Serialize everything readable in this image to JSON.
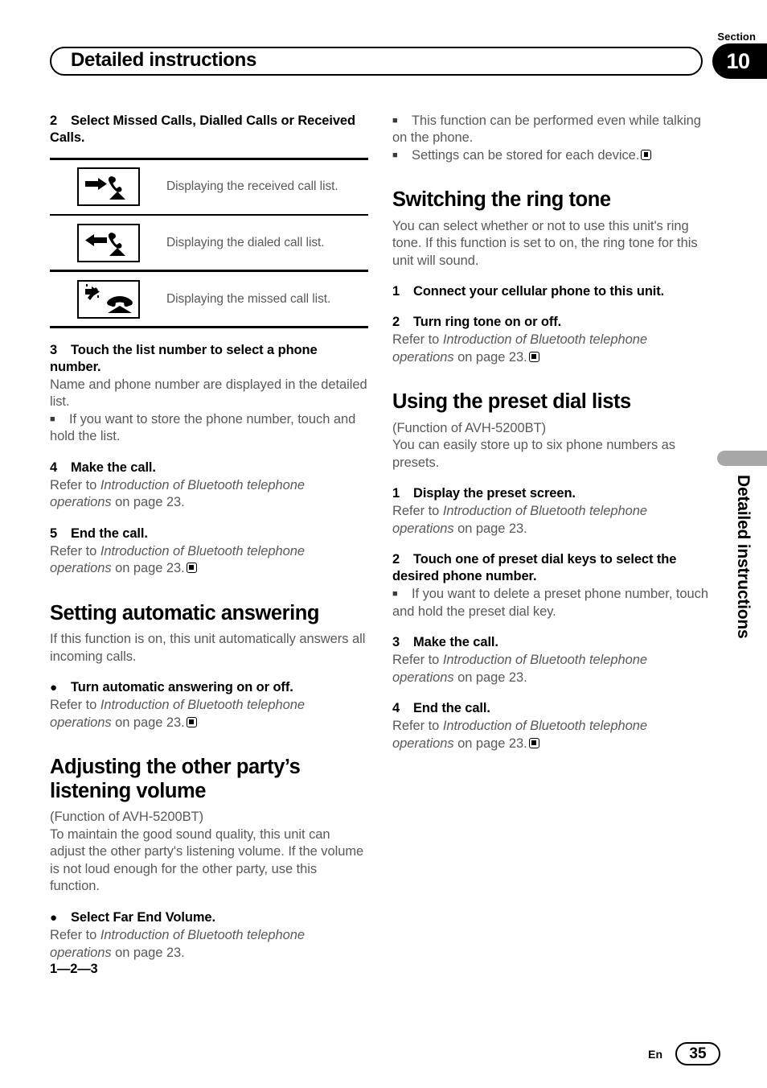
{
  "header": {
    "section_label": "Section",
    "section_number": "10",
    "title": "Detailed instructions"
  },
  "sidebar": {
    "vertical_label": "Detailed instructions"
  },
  "footer": {
    "language": "En",
    "page_number": "35"
  },
  "left_column": {
    "step2": {
      "number": "2",
      "text": "Select Missed Calls, Dialled Calls or Received Calls."
    },
    "icon_table": {
      "rows": [
        {
          "icon": "received-call-icon",
          "description": "Displaying the received call list."
        },
        {
          "icon": "dialed-call-icon",
          "description": "Displaying the dialed call list."
        },
        {
          "icon": "missed-call-icon",
          "description": "Displaying the missed call list."
        }
      ]
    },
    "step3": {
      "number": "3",
      "text": "Touch the list number to select a phone number.",
      "body": "Name and phone number are displayed in the detailed list.",
      "note": "If you want to store the phone number, touch and hold the list."
    },
    "step4": {
      "number": "4",
      "text": "Make the call.",
      "refer_prefix": "Refer to ",
      "refer_italic": "Introduction of Bluetooth telephone operations",
      "refer_suffix": " on page 23."
    },
    "step5": {
      "number": "5",
      "text": "End the call.",
      "refer_prefix": "Refer to ",
      "refer_italic": "Introduction of Bluetooth telephone operations",
      "refer_suffix": " on page 23."
    },
    "heading_auto_answer": "Setting automatic answering",
    "auto_answer_body": "If this function is on, this unit automatically answers all incoming calls.",
    "auto_answer_bullet": {
      "marker": "●",
      "text": "Turn automatic answering on or off.",
      "refer_prefix": "Refer to ",
      "refer_italic": "Introduction of Bluetooth telephone operations",
      "refer_suffix": " on page 23."
    },
    "heading_listening_volume": "Adjusting the other party’s listening volume",
    "listening_volume_function": "(Function of AVH-5200BT)",
    "listening_volume_body": "To maintain the good sound quality, this unit can adjust the other party's listening volume. If the volume is not loud enough for the other party, use this function.",
    "far_end_bullet": {
      "marker": "●",
      "text": "Select Far End Volume.",
      "refer_prefix": "Refer to ",
      "refer_italic": "Introduction of Bluetooth telephone operations",
      "refer_suffix": " on page 23."
    },
    "sequence": "1—2—3"
  },
  "right_column": {
    "note1": "This function can be performed even while talking on the phone.",
    "note2": "Settings can be stored for each device.",
    "heading_ring_tone": "Switching the ring tone",
    "ring_tone_body": "You can select whether or not to use this unit's ring tone. If this function is set to on, the ring tone for this unit will sound.",
    "ring_step1": {
      "number": "1",
      "text": "Connect your cellular phone to this unit."
    },
    "ring_step2": {
      "number": "2",
      "text": "Turn ring tone on or off.",
      "refer_prefix": "Refer to ",
      "refer_italic": "Introduction of Bluetooth telephone operations",
      "refer_suffix": " on page 23."
    },
    "heading_preset_dial": "Using the preset dial lists",
    "preset_function": "(Function of AVH-5200BT)",
    "preset_body": "You can easily store up to six phone numbers as presets.",
    "preset_step1": {
      "number": "1",
      "text": "Display the preset screen.",
      "refer_prefix": "Refer to ",
      "refer_italic": "Introduction of Bluetooth telephone operations",
      "refer_suffix": " on page 23."
    },
    "preset_step2": {
      "number": "2",
      "text": "Touch one of preset dial keys to select the desired phone number.",
      "note": "If you want to delete a preset phone number, touch and hold the preset dial key."
    },
    "preset_step3": {
      "number": "3",
      "text": "Make the call.",
      "refer_prefix": "Refer to ",
      "refer_italic": "Introduction of Bluetooth telephone operations",
      "refer_suffix": " on page 23."
    },
    "preset_step4": {
      "number": "4",
      "text": "End the call.",
      "refer_prefix": "Refer to ",
      "refer_italic": "Introduction of Bluetooth telephone operations",
      "refer_suffix": " on page 23."
    }
  },
  "colors": {
    "body_text": "#58595b",
    "heading": "#000000",
    "side_tab": "#a7a7a7"
  }
}
